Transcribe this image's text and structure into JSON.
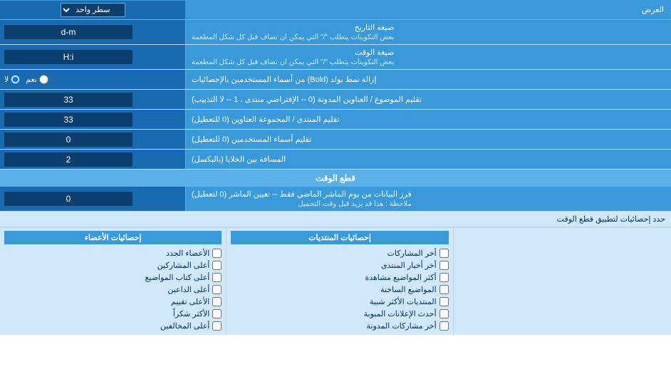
{
  "page": {
    "title": "العرض"
  },
  "rows": [
    {
      "id": "display_mode",
      "label": "العرض",
      "input_type": "select",
      "input_value": "سطر واحد"
    },
    {
      "id": "date_format",
      "label": "صيغة التاريخ",
      "sublabel": "بعض التكوينات يتطلب \"/\" التي يمكن ان تضاف قبل كل شكل المطعمة",
      "input_type": "text",
      "input_value": "d-m"
    },
    {
      "id": "time_format",
      "label": "صيغة الوقت",
      "sublabel": "بعض التكوينات يتطلب \"/\" التي يمكن ان تضاف قبل كل شكل المطعمة",
      "input_type": "text",
      "input_value": "H:i"
    },
    {
      "id": "bold_remove",
      "label": "إزالة نمط بولد (Bold) من أسماء المستخدمين بالإحصائيات",
      "input_type": "radio",
      "radio_yes": "نعم",
      "radio_no": "لا",
      "radio_selected": "no"
    },
    {
      "id": "subject_trim",
      "label": "تقليم الموضوع / العناوين المدونة (0 -- الإفتراضي منتدى ، 1 -- لا التذبيب)",
      "input_type": "text",
      "input_value": "33"
    },
    {
      "id": "forum_trim",
      "label": "تقليم المنتدى / المجموعة العناوين (0 للتعطيل)",
      "input_type": "text",
      "input_value": "33"
    },
    {
      "id": "usernames_trim",
      "label": "تقليم أسماء المستخدمين (0 للتعطيل)",
      "input_type": "text",
      "input_value": "0"
    },
    {
      "id": "cell_spacing",
      "label": "المسافة بين الخلايا (بالبكسل)",
      "input_type": "text",
      "input_value": "2"
    }
  ],
  "realtime_section": {
    "title": "قطع الوقت",
    "rows": [
      {
        "id": "realtime_filter",
        "label": "فرز البيانات من يوم الماشر الماضي فقط -- تعيين الماشر (0 لتعطيل)",
        "sublabel": "ملاحظة : هذا قد يزيد قبل وقت التحميل",
        "input_type": "text",
        "input_value": "0"
      }
    ]
  },
  "stats_section": {
    "limit_label": "حدد إحصائيات لتطبيق قطع الوقت",
    "col1_title": "إحصائيات المنتديات",
    "col1_items": [
      "أخر المشاركات",
      "أخر أخبار المنتدى",
      "أكثر المواضيع مشاهدة",
      "المواضيع الساخنة",
      "المنتديات الأكثر شبية",
      "أحدث الإعلانات المبوبة",
      "أخر مشاركات المدونة"
    ],
    "col2_title": "إحصائيات الأعضاء",
    "col2_items": [
      "الأعضاء الجدد",
      "أعلى المشاركين",
      "أعلى كتاب المواضيع",
      "أعلى الداعين",
      "الأعلى تقييم",
      "الأكثر شكراً",
      "أعلى المخالفين"
    ]
  }
}
